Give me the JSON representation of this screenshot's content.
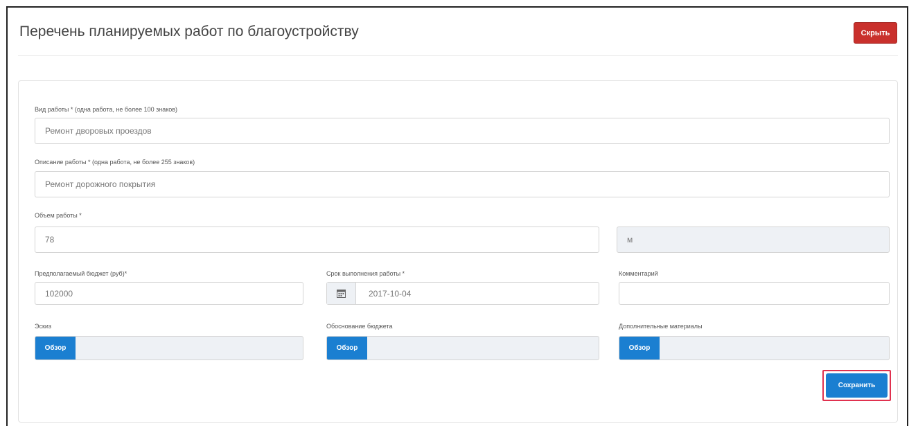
{
  "header": {
    "title": "Перечень планируемых работ по благоустройству",
    "hide_label": "Скрыть"
  },
  "form": {
    "work_type": {
      "label": "Вид работы * (одна работа, не более 100 знаков)",
      "value": "Ремонт дворовых проездов"
    },
    "work_description": {
      "label": "Описание работы * (одна работа, не более 255 знаков)",
      "value": "Ремонт дорожного покрытия"
    },
    "work_volume": {
      "label": "Объем работы *",
      "value": "78",
      "unit": "м"
    },
    "budget": {
      "label": "Предполагаемый бюджет (руб)*",
      "value": "102000"
    },
    "deadline": {
      "label": "Срок выполнения работы *",
      "value": "2017-10-04",
      "icon": "calendar-icon"
    },
    "comment": {
      "label": "Комментарий",
      "value": ""
    },
    "sketch": {
      "label": "Эскиз",
      "button": "Обзор"
    },
    "budget_justification": {
      "label": "Обоснование бюджета",
      "button": "Обзор"
    },
    "additional_materials": {
      "label": "Дополнительные материалы",
      "button": "Обзор"
    },
    "save_label": "Сохранить"
  },
  "colors": {
    "primary": "#1b7fd1",
    "danger": "#c9302c",
    "highlight": "#e0314f"
  }
}
